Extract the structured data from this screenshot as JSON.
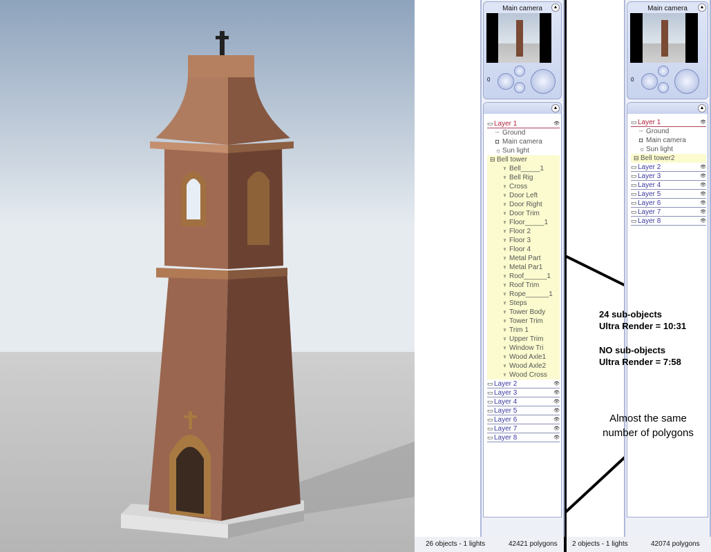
{
  "panel_a": {
    "camera_title": "Main camera",
    "counter": "0",
    "layer1": "Layer 1",
    "items": [
      "Ground",
      "Main camera",
      "Sun light",
      "Bell tower"
    ],
    "children": [
      "Bell_____1",
      "Bell Rig",
      "Cross",
      "Door Left",
      "Door Right",
      "Door Trim",
      "Floor_____1",
      "Floor 2",
      "Floor 3",
      "Floor 4",
      "Metal Part",
      "Metal Par1",
      "Roof______1",
      "Roof Trim",
      "Rope______1",
      "Steps",
      "Tower Body",
      "Tower Trim",
      "Trim 1",
      "Upper Trim",
      "Window Tri",
      "Wood Axle1",
      "Wood Axle2",
      "Wood Cross"
    ],
    "layers": [
      "Layer 2",
      "Layer 3",
      "Layer 4",
      "Layer 5",
      "Layer 6",
      "Layer 7",
      "Layer 8"
    ],
    "status_objects": "26 objects - 1 lights",
    "status_polygons": "42421 polygons"
  },
  "panel_b": {
    "camera_title": "Main camera",
    "counter": "0",
    "layer1": "Layer 1",
    "items": [
      "Ground",
      "Main camera",
      "Sun light",
      "Bell tower2"
    ],
    "layers": [
      "Layer 2",
      "Layer 3",
      "Layer 4",
      "Layer 5",
      "Layer 6",
      "Layer 7",
      "Layer 8"
    ],
    "status_objects": "2 objects - 1 lights",
    "status_polygons": "42074 polygons"
  },
  "annotations": {
    "sub_line1": "24 sub-objects",
    "sub_line2": "Ultra Render = 10:31",
    "no_line1": "NO sub-objects",
    "no_line2": "Ultra Render = 7:58",
    "poly_line1": "Almost the same",
    "poly_line2": "number of polygons"
  }
}
